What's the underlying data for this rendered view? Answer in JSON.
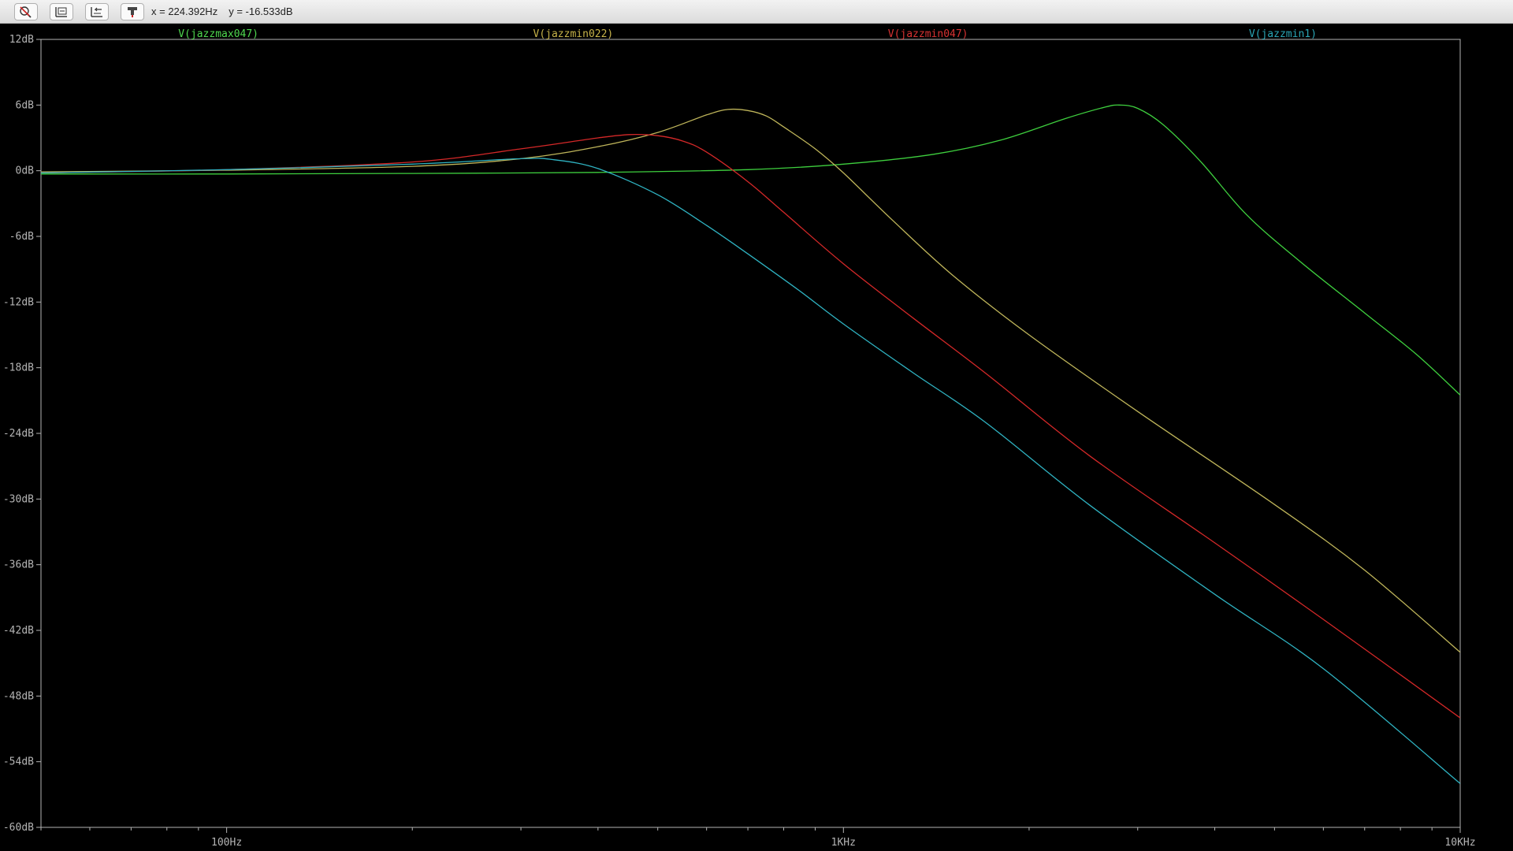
{
  "toolbar": {
    "buttons": [
      {
        "name": "autorange-button",
        "icon": "autorange-icon"
      },
      {
        "name": "zoom-extents-button",
        "icon": "zoom-extents-icon"
      },
      {
        "name": "zoom-back-button",
        "icon": "zoom-back-icon"
      },
      {
        "name": "cursor-probe-button",
        "icon": "probe-icon"
      }
    ],
    "cursor_x": "x = 224.392Hz",
    "cursor_y": "y = -16.533dB"
  },
  "colors": {
    "background": "#000000",
    "axis": "#b4b4b4",
    "tick_label": "#b4b4b4"
  },
  "chart_data": {
    "type": "line",
    "x_scale": "log",
    "xlim": [
      50,
      10000
    ],
    "ylim": [
      -60,
      12
    ],
    "x_ticks": [
      {
        "value": 100,
        "label": "100Hz"
      },
      {
        "value": 1000,
        "label": "1KHz"
      },
      {
        "value": 10000,
        "label": "10KHz"
      }
    ],
    "y_ticks": [
      {
        "value": 12,
        "label": "12dB"
      },
      {
        "value": 6,
        "label": "6dB"
      },
      {
        "value": 0,
        "label": "0dB"
      },
      {
        "value": -6,
        "label": "-6dB"
      },
      {
        "value": -12,
        "label": "-12dB"
      },
      {
        "value": -18,
        "label": "-18dB"
      },
      {
        "value": -24,
        "label": "-24dB"
      },
      {
        "value": -30,
        "label": "-30dB"
      },
      {
        "value": -36,
        "label": "-36dB"
      },
      {
        "value": -42,
        "label": "-42dB"
      },
      {
        "value": -48,
        "label": "-48dB"
      },
      {
        "value": -54,
        "label": "-54dB"
      },
      {
        "value": -60,
        "label": "-60dB"
      }
    ],
    "grid": false,
    "legend": "top",
    "series": [
      {
        "name": "V(jazzmax047)",
        "color": "#3ecf3e",
        "label_color": "#4fd84f",
        "x": [
          50,
          100,
          200,
          400,
          700,
          1000,
          1400,
          1800,
          2300,
          2650,
          2800,
          3000,
          3300,
          3800,
          4500,
          5500,
          7000,
          8500,
          10000
        ],
        "y": [
          -0.3,
          -0.3,
          -0.25,
          -0.15,
          0.1,
          0.6,
          1.5,
          2.8,
          4.8,
          5.8,
          6.0,
          5.7,
          4.2,
          0.8,
          -4.0,
          -8.3,
          -13.0,
          -16.8,
          -20.5
        ]
      },
      {
        "name": "V(jazzmin022)",
        "color": "#bfb55a",
        "label_color": "#c8b44a",
        "x": [
          50,
          100,
          200,
          300,
          400,
          500,
          600,
          650,
          700,
          750,
          800,
          900,
          1000,
          1200,
          1500,
          2000,
          3000,
          5000,
          7000,
          10000
        ],
        "y": [
          -0.1,
          0.05,
          0.4,
          1.1,
          2.2,
          3.5,
          5.1,
          5.6,
          5.5,
          5.0,
          4.0,
          2.0,
          -0.2,
          -4.5,
          -9.5,
          -15.0,
          -22.0,
          -30.5,
          -36.5,
          -44.0
        ]
      },
      {
        "name": "V(jazzmin047)",
        "color": "#d42828",
        "label_color": "#d83232",
        "x": [
          50,
          100,
          200,
          300,
          400,
          450,
          500,
          550,
          600,
          700,
          800,
          1000,
          1300,
          1700,
          2500,
          4000,
          6000,
          10000
        ],
        "y": [
          -0.2,
          0.1,
          0.8,
          2.0,
          3.0,
          3.3,
          3.2,
          2.7,
          1.7,
          -1.0,
          -3.8,
          -8.5,
          -13.5,
          -18.5,
          -26.0,
          -34.0,
          -41.0,
          -50.0
        ]
      },
      {
        "name": "V(jazzmin1)",
        "color": "#2fb3c2",
        "label_color": "#2aa5b5",
        "x": [
          50,
          100,
          200,
          300,
          340,
          400,
          500,
          600,
          700,
          850,
          1000,
          1300,
          1700,
          2500,
          4000,
          6000,
          10000
        ],
        "y": [
          -0.2,
          0.1,
          0.6,
          1.1,
          1.0,
          0.2,
          -2.2,
          -5.0,
          -7.6,
          -11.0,
          -14.0,
          -18.5,
          -23.0,
          -30.5,
          -38.7,
          -45.5,
          -56.0
        ]
      }
    ]
  }
}
